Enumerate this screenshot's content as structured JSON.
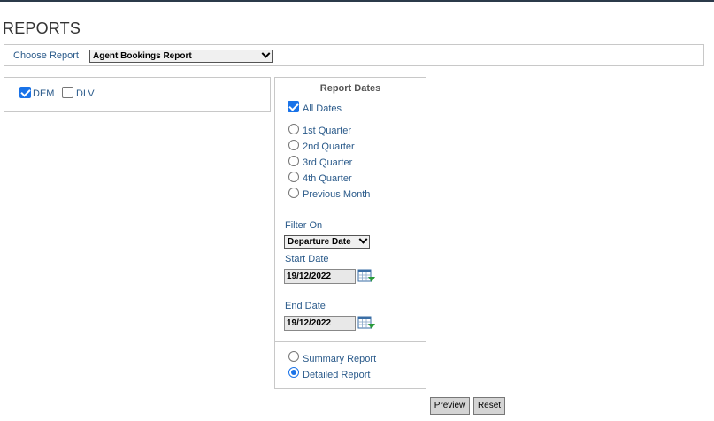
{
  "page": {
    "title": "REPORTS"
  },
  "choose_report": {
    "label": "Choose Report",
    "selected": "Agent Bookings Report"
  },
  "companies": [
    {
      "label": "DEM",
      "checked": true
    },
    {
      "label": "DLV",
      "checked": false
    }
  ],
  "report_dates": {
    "title": "Report Dates",
    "all_dates": {
      "label": "All Dates",
      "checked": true
    },
    "options": [
      {
        "label": "1st Quarter",
        "selected": false
      },
      {
        "label": "2nd Quarter",
        "selected": false
      },
      {
        "label": "3rd Quarter",
        "selected": false
      },
      {
        "label": "4th Quarter",
        "selected": false
      },
      {
        "label": "Previous Month",
        "selected": false
      }
    ],
    "filter_on": {
      "label": "Filter On",
      "selected": "Departure Date"
    },
    "start_date": {
      "label": "Start Date",
      "value": "19/12/2022"
    },
    "end_date": {
      "label": "End Date",
      "value": "19/12/2022"
    }
  },
  "report_type": [
    {
      "label": "Summary Report",
      "selected": false
    },
    {
      "label": "Detailed Report",
      "selected": true
    }
  ],
  "buttons": {
    "preview": "Preview",
    "reset": "Reset"
  },
  "icons": {
    "calendar": "calendar-icon",
    "dropdown": "chevron-down-icon"
  },
  "colors": {
    "accent": "#1a73e8",
    "label": "#2a5a8a",
    "top_bar": "#2b3a4a"
  }
}
